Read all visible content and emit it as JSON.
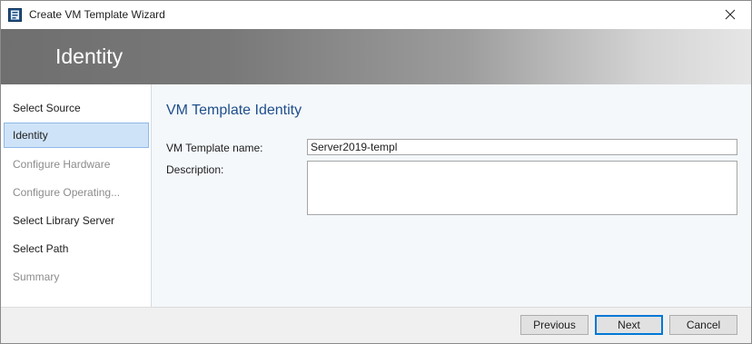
{
  "window": {
    "title": "Create VM Template Wizard",
    "icon": "wizard-app-icon",
    "close_icon": "close-icon"
  },
  "banner": {
    "title": "Identity"
  },
  "nav": {
    "items": [
      {
        "label": "Select Source",
        "state": "enabled"
      },
      {
        "label": "Identity",
        "state": "selected"
      },
      {
        "label": "Configure Hardware",
        "state": "disabled"
      },
      {
        "label": "Configure Operating...",
        "state": "disabled"
      },
      {
        "label": "Select Library Server",
        "state": "enabled"
      },
      {
        "label": "Select Path",
        "state": "enabled"
      },
      {
        "label": "Summary",
        "state": "disabled"
      }
    ]
  },
  "main": {
    "section_title": "VM Template Identity",
    "name_label": "VM Template name:",
    "name_value": "Server2019-templ",
    "description_label": "Description:",
    "description_value": ""
  },
  "footer": {
    "previous_label": "Previous",
    "next_label": "Next",
    "cancel_label": "Cancel"
  },
  "colors": {
    "accent": "#0078d7",
    "section_title": "#1f4e8c",
    "selected_bg": "#cfe3f8",
    "disabled_text": "#8c8c8c"
  }
}
